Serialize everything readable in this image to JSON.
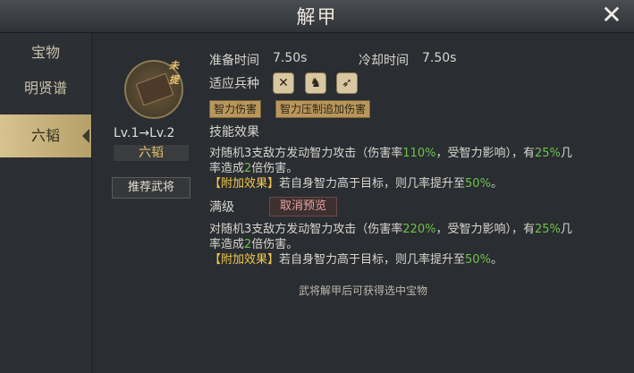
{
  "header": {
    "title": "解甲"
  },
  "sidebar": {
    "items": [
      {
        "label": "宝物"
      },
      {
        "label": "明贤谱"
      },
      {
        "label": "六韬"
      }
    ]
  },
  "item": {
    "badge": "未提",
    "level_text": "Lv.1→Lv.2",
    "name": "六韬",
    "recommend_label": "推荐武将"
  },
  "stats": {
    "prep_label": "准备时间",
    "prep_value": "7.50s",
    "cooldown_label": "冷却时间",
    "cooldown_value": "7.50s",
    "troops_label": "适应兵种"
  },
  "tags": [
    "智力伤害",
    "智力压制追加伤害"
  ],
  "skill": {
    "title": "技能效果",
    "line1_a": "对随机3支敌方发动智力攻击（伤害率",
    "line1_rate": "110%",
    "line1_b": "，受智力影响），有",
    "line1_prob": "25%",
    "line1_c": "几",
    "line2_a": "率造成",
    "line2_mult": "2",
    "line2_b": "倍伤害。",
    "extra_tag": "【附加效果】",
    "extra_text": "若自身智力高于目标，则几率提升至",
    "extra_value": "50%",
    "extra_end": "。"
  },
  "max": {
    "title": "满级",
    "cancel_label": "取消预览",
    "line1_a": "对随机3支敌方发动智力攻击（伤害率",
    "line1_rate": "220%",
    "line1_b": "，受智力影响），有",
    "line1_prob": "25%",
    "line1_c": "几",
    "line2_a": "率造成",
    "line2_mult": "2",
    "line2_b": "倍伤害。",
    "extra_tag": "【附加效果】",
    "extra_text": "若自身智力高于目标，则几率提升至",
    "extra_value": "50%",
    "extra_end": "。"
  },
  "footer": {
    "note": "武将解甲后可获得选中宝物"
  }
}
